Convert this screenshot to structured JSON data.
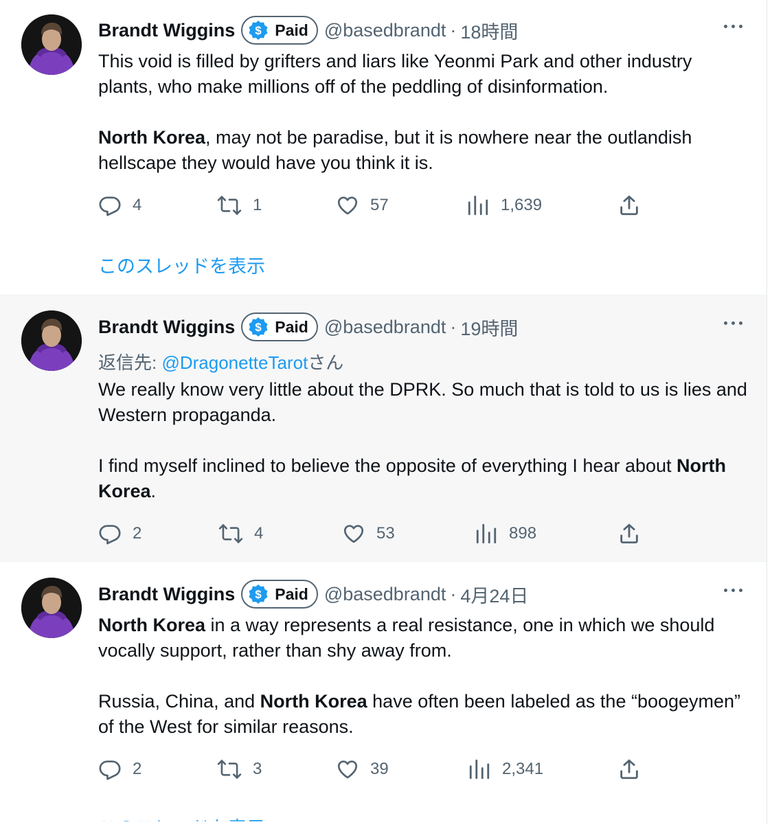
{
  "colors": {
    "accent": "#1d9bf0",
    "secondary_text": "#536471",
    "hover_bg": "#f7f7f8",
    "avatar_hood": "#7b3fbe"
  },
  "icons": [
    "paid-badge-coin-icon",
    "more-icon",
    "reply-icon",
    "retweet-icon",
    "like-icon",
    "views-icon",
    "share-icon"
  ],
  "tweets": [
    {
      "name": "Brandt Wiggins",
      "badge": "Paid",
      "handle": "@basedbrandt",
      "sep": "·",
      "time": "18時間",
      "p1_text": "This void is filled by grifters and liars like Yeonmi Park and other industry plants, who make millions off of the peddling of disinformation.",
      "p2_bold": "North Korea",
      "p2_text": ", may not be paradise, but it is nowhere near the outlandish hellscape they would have you think it is.",
      "replies": "4",
      "retweets": "1",
      "likes": "57",
      "views": "1,639",
      "thread_link": "このスレッドを表示"
    },
    {
      "name": "Brandt Wiggins",
      "badge": "Paid",
      "handle": "@basedbrandt",
      "sep": "·",
      "time": "19時間",
      "reply_prefix": "返信先: ",
      "reply_mention": "@DragonetteTarot",
      "reply_suffix": "さん",
      "p1_text": "We really know very little about the DPRK. So much that is told to us is lies and Western propaganda.",
      "p2_text": "I find myself inclined to believe the opposite of everything I hear about ",
      "p2_bold": "North Korea",
      "p2_end": ".",
      "replies": "2",
      "retweets": "4",
      "likes": "53",
      "views": "898"
    },
    {
      "name": "Brandt Wiggins",
      "badge": "Paid",
      "handle": "@basedbrandt",
      "sep": "·",
      "time": "4月24日",
      "p1_bold": "North Korea",
      "p1_text": " in a way represents a real resistance, one in which we should vocally support, rather than shy away from.",
      "p2_text": "Russia, China, and ",
      "p2_bold": "North Korea",
      "p2_end": " have often been labeled as the “boogeymen” of the West for similar reasons.",
      "replies": "2",
      "retweets": "3",
      "likes": "39",
      "views": "2,341",
      "thread_link": "このスレッドを表示"
    }
  ]
}
